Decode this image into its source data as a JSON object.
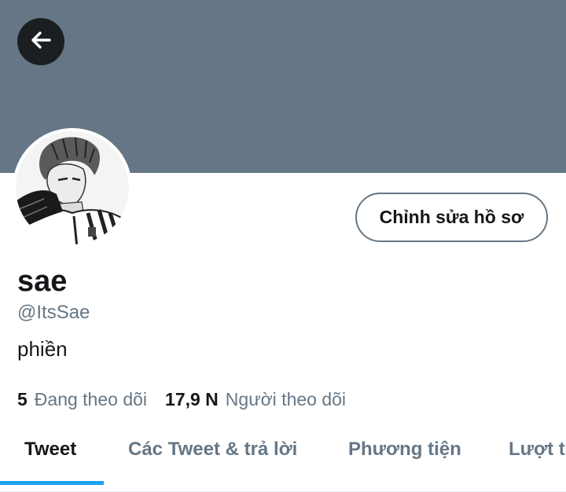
{
  "header": {
    "banner_color": "#657786",
    "back_icon": "arrow-left-icon"
  },
  "profile": {
    "display_name": "sae",
    "handle": "@ItsSae",
    "bio": "phiền",
    "edit_button_label": "Chỉnh sửa hồ sơ",
    "avatar": "manga-character-avatar"
  },
  "stats": {
    "following_count": "5",
    "following_label": "Đang theo dõi",
    "followers_count": "17,9 N",
    "followers_label": "Người theo dõi"
  },
  "tabs": [
    {
      "label": "Tweet",
      "active": true
    },
    {
      "label": "Các Tweet & trả lời",
      "active": false
    },
    {
      "label": "Phương tiện",
      "active": false
    },
    {
      "label": "Lượt thích",
      "active": false
    }
  ],
  "colors": {
    "accent": "#1da1f2",
    "secondary_text": "#657786",
    "primary_text": "#14171a"
  }
}
